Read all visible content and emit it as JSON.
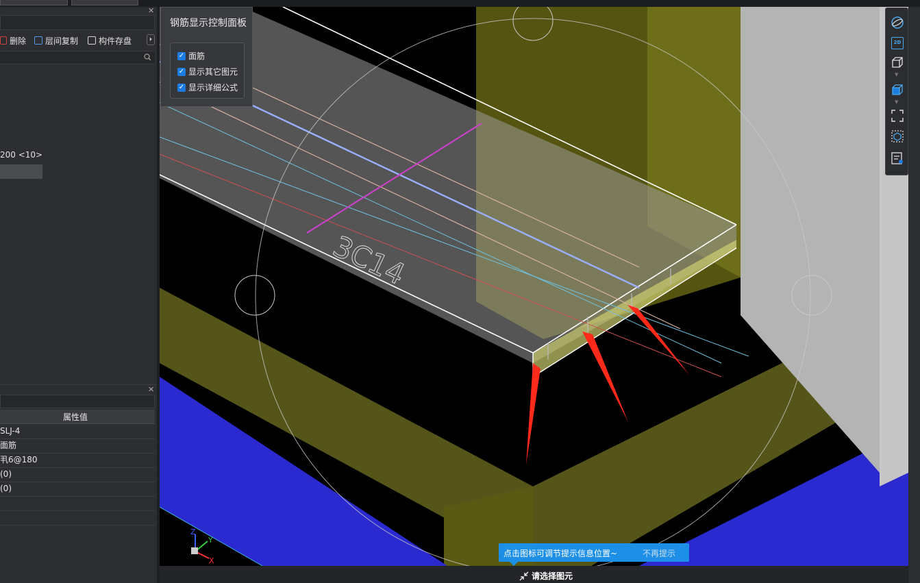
{
  "toolbar": {
    "delete_label": "删除",
    "floor_copy_label": "层间复制",
    "save_component_label": "构件存盘"
  },
  "tree": {
    "item_label": "200 <10>"
  },
  "properties": {
    "header_value": "属性值",
    "rows": [
      "SLJ-4",
      "面筋",
      "丮6@180",
      "(0)",
      "(0)",
      "",
      ""
    ]
  },
  "control_panel": {
    "title": "钢筋显示控制面板",
    "options": [
      {
        "label": "面筋",
        "checked": true
      },
      {
        "label": "显示其它图元",
        "checked": true
      },
      {
        "label": "显示详细公式",
        "checked": true
      }
    ]
  },
  "viewport": {
    "rebar_label": "3C14",
    "axis_x": "X",
    "axis_y": "Y",
    "axis_z": "Z"
  },
  "right_toolbar": {
    "items": [
      "orbit-icon",
      "2d-view-icon",
      "3d-box-icon",
      "3d-box-filled-icon",
      "fit-selection-icon",
      "select-box-icon",
      "report-icon"
    ],
    "label_2d": "2D"
  },
  "tooltip": {
    "message": "点击图标可调节提示信息位置~",
    "dismiss": "不再提示"
  },
  "status": {
    "prompt": "请选择图元"
  },
  "colors": {
    "accent": "#1e8fe6",
    "olive": "#5a5a14",
    "blue_floor": "#2a2ad0",
    "annotation_arrow": "#ff2a1a"
  }
}
